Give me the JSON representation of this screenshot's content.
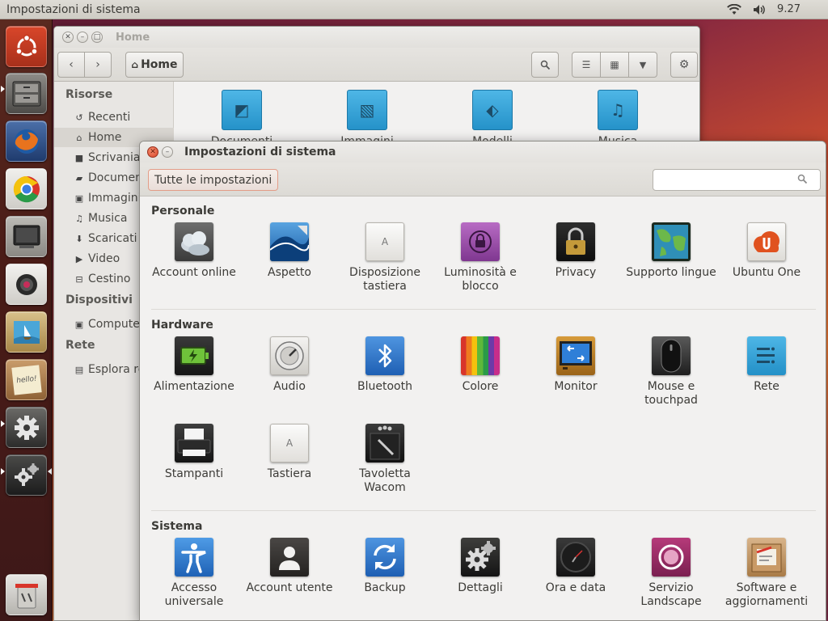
{
  "top_panel": {
    "title": "Impostazioni di sistema",
    "clock": "9.27",
    "icons": [
      "wifi-icon",
      "volume-icon"
    ]
  },
  "launcher": {
    "items": [
      "ubuntu-dash-icon",
      "file-manager-icon",
      "firefox-icon",
      "chrome-icon",
      "monitor-app-icon",
      "webcam-icon",
      "photo-viewer-icon",
      "notes-icon",
      "system-settings-icon",
      "settings-details-icon",
      "trash-icon"
    ],
    "notes_text": "hello!"
  },
  "nautilus": {
    "title": "Home",
    "location": "Home",
    "sidebar": {
      "resources_header": "Risorse",
      "devices_header": "Dispositivi",
      "network_header": "Rete",
      "items": [
        "Recenti",
        "Home",
        "Scrivania",
        "Documenti",
        "Immagini",
        "Musica",
        "Scaricati",
        "Video",
        "Cestino"
      ],
      "devices": [
        "Computer"
      ],
      "network": [
        "Esplora rete"
      ]
    },
    "folders": [
      "Documenti",
      "Immagini",
      "Modelli",
      "Musica"
    ]
  },
  "settings": {
    "title": "Impostazioni di sistema",
    "all_settings": "Tutte le impostazioni",
    "search_placeholder": "",
    "sections": [
      {
        "title": "Personale",
        "items": [
          {
            "label": "Account online",
            "icon": "online-accounts-icon"
          },
          {
            "label": "Aspetto",
            "icon": "appearance-icon"
          },
          {
            "label": "Disposizione tastiera",
            "icon": "keyboard-layout-icon",
            "glyph": "A"
          },
          {
            "label": "Luminosità e blocco",
            "icon": "brightness-lock-icon"
          },
          {
            "label": "Privacy",
            "icon": "privacy-icon"
          },
          {
            "label": "Supporto lingue",
            "icon": "language-support-icon"
          },
          {
            "label": "Ubuntu One",
            "icon": "ubuntu-one-icon"
          }
        ]
      },
      {
        "title": "Hardware",
        "items": [
          {
            "label": "Alimentazione",
            "icon": "power-icon"
          },
          {
            "label": "Audio",
            "icon": "sound-icon"
          },
          {
            "label": "Bluetooth",
            "icon": "bluetooth-icon"
          },
          {
            "label": "Colore",
            "icon": "color-icon"
          },
          {
            "label": "Monitor",
            "icon": "display-icon"
          },
          {
            "label": "Mouse e touchpad",
            "icon": "mouse-touchpad-icon"
          },
          {
            "label": "Rete",
            "icon": "network-icon"
          },
          {
            "label": "Stampanti",
            "icon": "printers-icon"
          },
          {
            "label": "Tastiera",
            "icon": "keyboard-icon",
            "glyph": "A"
          },
          {
            "label": "Tavoletta Wacom",
            "icon": "wacom-tablet-icon"
          }
        ]
      },
      {
        "title": "Sistema",
        "items": [
          {
            "label": "Accesso universale",
            "icon": "universal-access-icon"
          },
          {
            "label": "Account utente",
            "icon": "user-accounts-icon"
          },
          {
            "label": "Backup",
            "icon": "backup-icon"
          },
          {
            "label": "Dettagli",
            "icon": "details-icon"
          },
          {
            "label": "Ora e data",
            "icon": "time-date-icon"
          },
          {
            "label": "Servizio Landscape",
            "icon": "landscape-service-icon"
          },
          {
            "label": "Software e aggiornamenti",
            "icon": "software-updates-icon"
          }
        ]
      }
    ]
  }
}
